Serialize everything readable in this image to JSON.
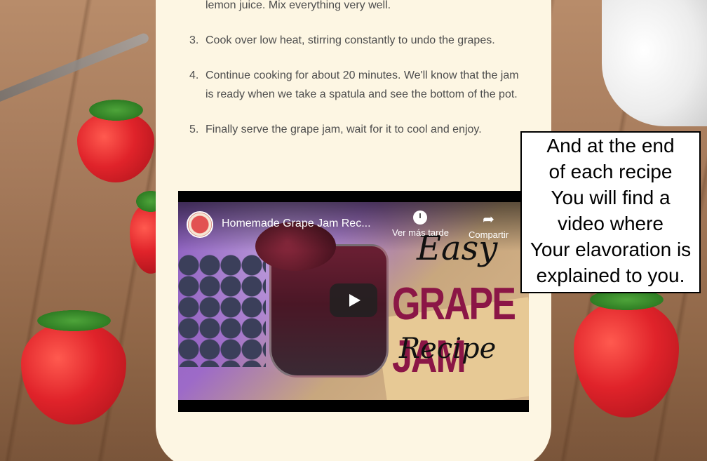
{
  "recipe": {
    "steps": [
      {
        "number": "",
        "text": "lemon juice. Mix everything very well."
      },
      {
        "number": "3.",
        "text": "Cook over low heat, stirring constantly to undo the grapes."
      },
      {
        "number": "4.",
        "text": "Continue cooking for about 20 minutes. We'll know that the jam is ready when we take a spatula and see the bottom of the pot."
      },
      {
        "number": "5.",
        "text": "Finally serve the grape jam, wait for it to cool and enjoy."
      }
    ]
  },
  "video": {
    "title": "Homemade Grape Jam Rec...",
    "watch_later_label": "Ver más tarde",
    "share_label": "Compartir",
    "thumbnail_text": {
      "line1": "Easy",
      "line2": "GRAPE JAM",
      "line3": "Recipe"
    },
    "icons": {
      "play": "play-icon",
      "clock": "clock-icon",
      "share": "share-arrow-icon",
      "channel": "channel-avatar"
    }
  },
  "callout": {
    "lines": [
      "And at the end",
      "of each recipe",
      "You will find a",
      "video where",
      "Your elavoration is",
      "explained to you."
    ]
  },
  "colors": {
    "card_background": "#fdf6e3",
    "step_text": "#4d4d4d",
    "grape_jam_title": "#8b1646",
    "video_bar": "#000000"
  }
}
